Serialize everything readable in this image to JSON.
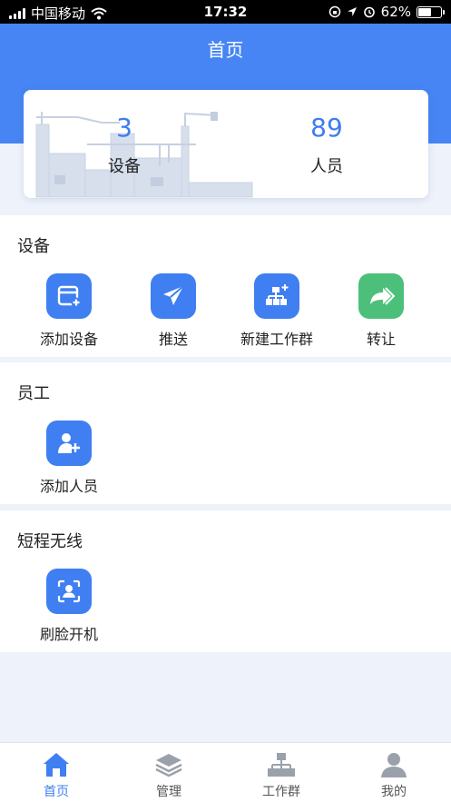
{
  "status_bar": {
    "carrier": "中国移动",
    "time": "17:32",
    "battery": "62%",
    "battery_level": 0.62
  },
  "header": {
    "title": "首页"
  },
  "summary": {
    "devices": {
      "count": "3",
      "label": "设备"
    },
    "people": {
      "count": "89",
      "label": "人员"
    }
  },
  "sections": {
    "devices": {
      "title": "设备",
      "items": [
        {
          "label": "添加设备",
          "icon": "add-device-icon"
        },
        {
          "label": "推送",
          "icon": "send-icon"
        },
        {
          "label": "新建工作群",
          "icon": "org-add-icon"
        },
        {
          "label": "转让",
          "icon": "forward-icon"
        }
      ]
    },
    "staff": {
      "title": "员工",
      "items": [
        {
          "label": "添加人员",
          "icon": "add-person-icon"
        }
      ]
    },
    "short_range": {
      "title": "短程无线",
      "items": [
        {
          "label": "刷脸开机",
          "icon": "face-scan-icon"
        }
      ]
    }
  },
  "tab_bar": {
    "tabs": [
      {
        "label": "首页",
        "icon": "home-icon",
        "active": true
      },
      {
        "label": "管理",
        "icon": "layers-icon"
      },
      {
        "label": "工作群",
        "icon": "org-chart-icon"
      },
      {
        "label": "我的",
        "icon": "person-icon"
      }
    ]
  },
  "colors": {
    "primary": "#4685f3",
    "icon_blue": "#3f7ff2",
    "icon_green": "#4cc07a",
    "background": "#eef2fa"
  }
}
